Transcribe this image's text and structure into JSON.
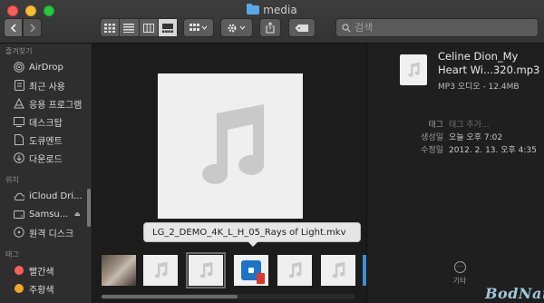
{
  "window": {
    "title": "media"
  },
  "toolbar": {
    "search": {
      "placeholder": "검색",
      "icon": "search-icon"
    }
  },
  "sidebar": {
    "favorites_header": "즐겨찾기",
    "favorites": [
      {
        "label": "AirDrop",
        "icon": "airdrop-icon"
      },
      {
        "label": "최근 사용",
        "icon": "recents-icon"
      },
      {
        "label": "응용 프로그램",
        "icon": "applications-icon"
      },
      {
        "label": "데스크탑",
        "icon": "desktop-icon"
      },
      {
        "label": "도큐멘트",
        "icon": "document-icon"
      },
      {
        "label": "다운로드",
        "icon": "download-icon"
      }
    ],
    "locations_header": "위치",
    "locations": [
      {
        "label": "iCloud Dri...",
        "icon": "icloud-icon"
      },
      {
        "label": "Samsu...",
        "icon": "drive-icon"
      },
      {
        "label": "원격 디스크",
        "icon": "remote-disc-icon"
      }
    ],
    "tags_header": "태그",
    "tags": [
      {
        "label": "빨간색",
        "color": "#ff5f57"
      },
      {
        "label": "주황색",
        "color": "#f5a623"
      }
    ]
  },
  "preview": {
    "tooltip": "LG_2_DEMO_4K_L_H_05_Rays of Light.mkv"
  },
  "info": {
    "name": "Celine Dion_My Heart Wi...320.mp3",
    "kind": "MP3 오디오 - 12.4MB",
    "tags_label": "태그",
    "tags_placeholder": "태그 추가...",
    "created_label": "생성일",
    "created_value": "오늘 오후 7:02",
    "modified_label": "수정일",
    "modified_value": "2012. 2. 13. 오후 4:35",
    "more_label": "기타"
  },
  "watermark": "BodNara"
}
